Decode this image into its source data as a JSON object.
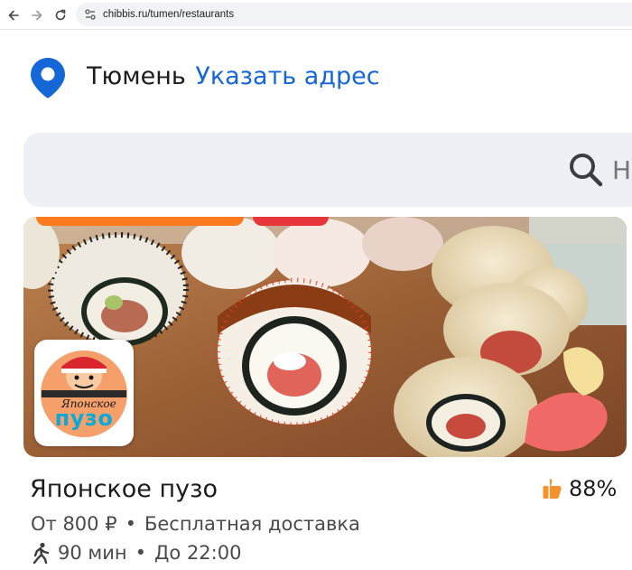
{
  "browser": {
    "url": "chibbis.ru/tumen/restaurants",
    "back_icon": "arrow-left-icon",
    "forward_icon": "arrow-right-icon",
    "reload_icon": "reload-icon"
  },
  "header": {
    "city": "Тюмень",
    "address_link": "Указать адрес"
  },
  "search": {
    "placeholder": "Н",
    "icon": "search-icon"
  },
  "restaurant": {
    "name": "Японское пузо",
    "rating": "88%",
    "rating_icon": "thumbs-up-icon",
    "min_order": "От 800 ₽",
    "delivery": "Бесплатная доставка",
    "time": "90 мин",
    "until": "До 22:00",
    "logo_text_main": "пузо",
    "logo_text_sub": "Японское",
    "colors": {
      "accent_blue": "#1566d6",
      "orange": "#f97b1e",
      "red": "#e8373a"
    }
  }
}
